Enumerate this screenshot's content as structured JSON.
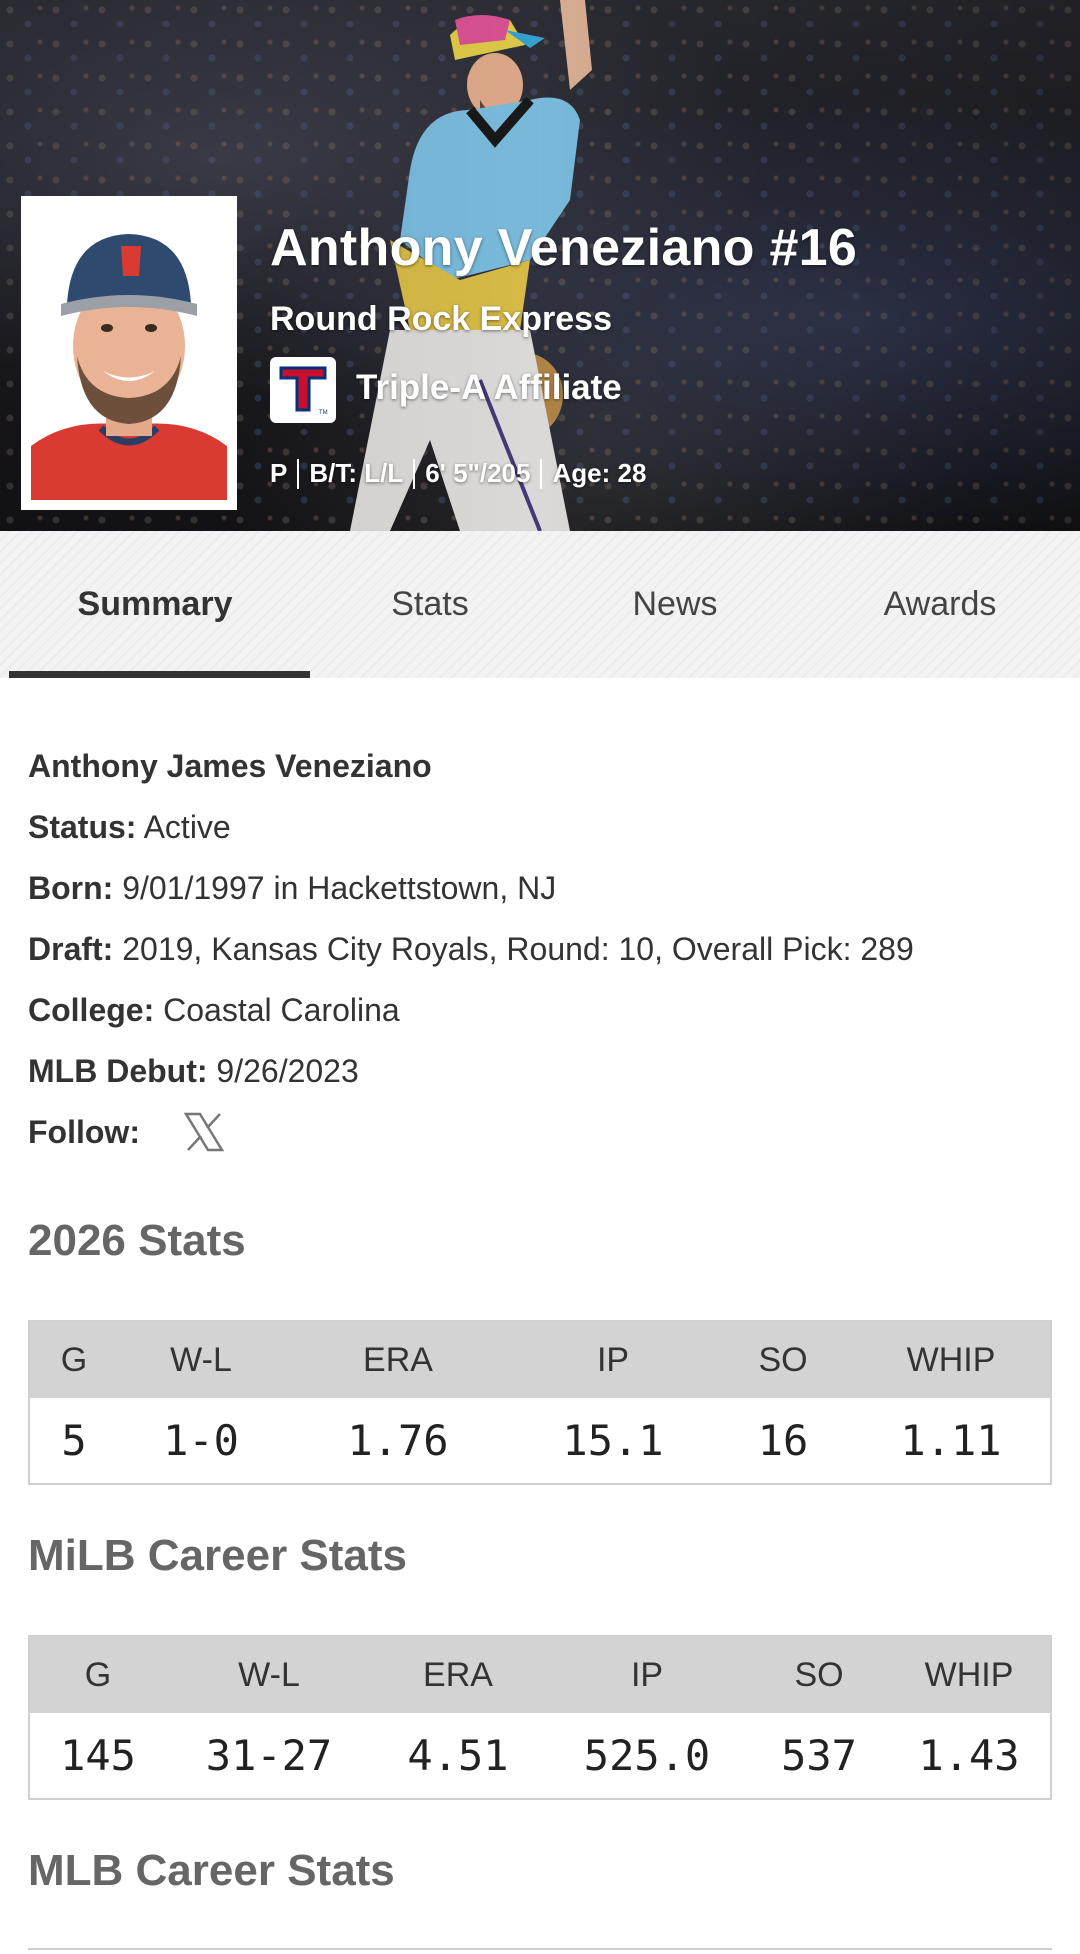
{
  "hero": {
    "player_name": "Anthony Veneziano #16",
    "team": "Round Rock Express",
    "affiliate": "Triple-A Affiliate",
    "bio": [
      "P",
      "B/T: L/L",
      "6' 5\"/205",
      "Age: 28"
    ]
  },
  "tabs": [
    {
      "label": "Summary",
      "active": true
    },
    {
      "label": "Stats",
      "active": false
    },
    {
      "label": "News",
      "active": false
    },
    {
      "label": "Awards",
      "active": false
    }
  ],
  "info": {
    "full_name": "Anthony James Veneziano",
    "status_label": "Status:",
    "status_value": " Active",
    "born_label": "Born:",
    "born_value": " 9/01/1997 in Hackettstown, NJ",
    "draft_label": "Draft:",
    "draft_value": " 2019, Kansas City Royals, Round: 10, Overall Pick: 289",
    "college_label": "College:",
    "college_value": " Coastal Carolina",
    "debut_label": "MLB Debut:",
    "debut_value": " 9/26/2023",
    "follow_label": "Follow:",
    "follow_icon": "x-icon"
  },
  "stats_2026": {
    "title": "2026 Stats",
    "headers": [
      "G",
      "W-L",
      "ERA",
      "IP",
      "SO",
      "WHIP"
    ],
    "values": [
      "5",
      "1-0",
      "1.76",
      "15.1",
      "16",
      "1.11"
    ]
  },
  "milb_career": {
    "title": "MiLB Career Stats",
    "headers": [
      "G",
      "W-L",
      "ERA",
      "IP",
      "SO",
      "WHIP"
    ],
    "values": [
      "145",
      "31-27",
      "4.51",
      "525.0",
      "537",
      "1.43"
    ]
  },
  "mlb_career": {
    "title": "MLB Career Stats"
  },
  "colors": {
    "tab_underline": "#333333",
    "table_header_bg": "#d3d3d3",
    "section_title": "#666666"
  }
}
